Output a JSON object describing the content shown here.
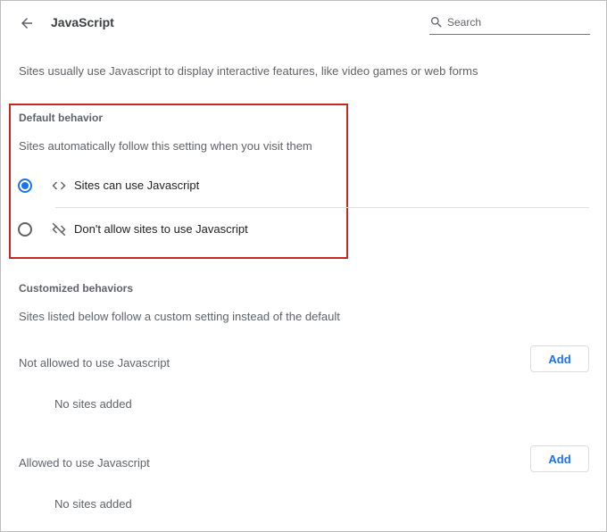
{
  "header": {
    "title": "JavaScript",
    "back_icon": "arrow-back-icon",
    "search": {
      "placeholder": "Search",
      "value": ""
    }
  },
  "description": "Sites usually use Javascript to display interactive features, like video games or web forms",
  "default_behavior": {
    "heading": "Default behavior",
    "subtitle": "Sites automatically follow this setting when you visit them",
    "options": [
      {
        "label": "Sites can use Javascript",
        "icon": "code-icon",
        "selected": true
      },
      {
        "label": "Don't allow sites to use Javascript",
        "icon": "code-off-icon",
        "selected": false
      }
    ]
  },
  "customized": {
    "heading": "Customized behaviors",
    "subtitle": "Sites listed below follow a custom setting instead of the default",
    "lists": [
      {
        "label": "Not allowed to use Javascript",
        "button": "Add",
        "empty_text": "No sites added"
      },
      {
        "label": "Allowed to use Javascript",
        "button": "Add",
        "empty_text": "No sites added"
      }
    ]
  },
  "colors": {
    "accent": "#1a73e8",
    "highlight_border": "#c62828"
  }
}
